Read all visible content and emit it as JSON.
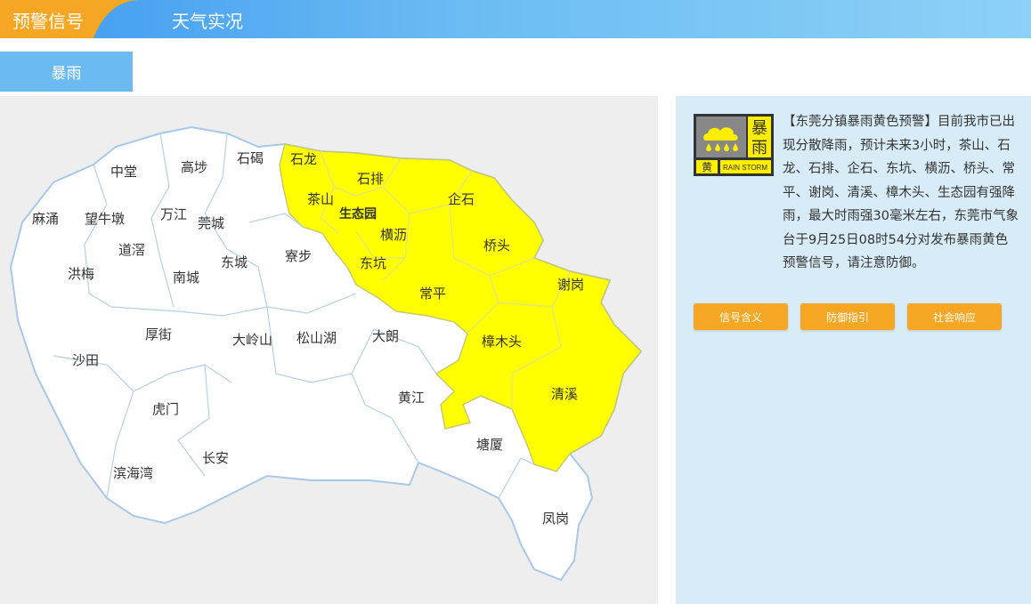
{
  "tabs": {
    "warning": "预警信号",
    "weather": "天气实况"
  },
  "subtab": "暴雨",
  "icon": {
    "name": "rainstorm-yellow-icon",
    "char1": "暴",
    "char2": "雨",
    "level": "黄",
    "en": "RAIN STORM",
    "color": "#ffee00"
  },
  "alert_text": "【东莞分镇暴雨黄色预警】目前我市已出现分散降雨，预计未来3小时，茶山、石龙、石排、企石、东坑、横沥、桥头、常平、谢岗、清溪、樟木头、生态园有强降雨，最大时雨强30毫米左右，东莞市气象台于9月25日08时54分对发布暴雨黄色预警信号，请注意防御。",
  "buttons": [
    "信号含义",
    "防御指引",
    "社会响应"
  ],
  "colors": {
    "warning_fill": "#ffff00",
    "orange": "#f5a623",
    "blue": "#3f9af0"
  },
  "map": {
    "towns": [
      "中堂",
      "高埗",
      "石碣",
      "石龙",
      "石排",
      "茶山",
      "生态园",
      "企石",
      "麻涌",
      "望牛墩",
      "万江",
      "莞城",
      "横沥",
      "桥头",
      "道滘",
      "东城",
      "寮步",
      "东坑",
      "洪梅",
      "南城",
      "常平",
      "谢岗",
      "厚街",
      "大岭山",
      "松山湖",
      "大朗",
      "樟木头",
      "沙田",
      "黄江",
      "清溪",
      "虎门",
      "塘厦",
      "长安",
      "滨海湾",
      "凤岗"
    ]
  }
}
